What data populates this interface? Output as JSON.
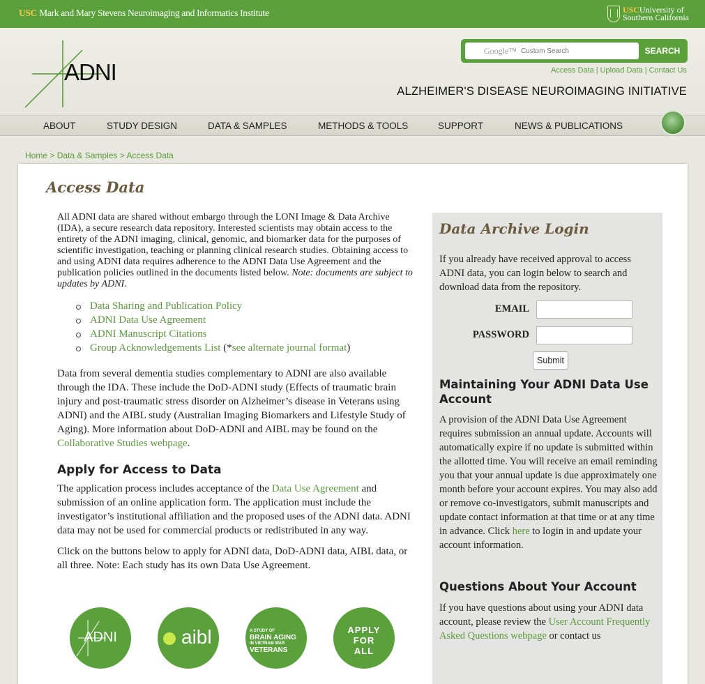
{
  "topbar": {
    "institute_usc": "USC",
    "institute_name": "Mark and Mary Stevens Neuroimaging and Informatics Institute",
    "university_usc": "USC",
    "university_line1": "University of",
    "university_line2": "Southern California"
  },
  "header": {
    "logo_text": "ADNI",
    "search": {
      "placeholder": "Custom Search",
      "google_label": "Google™",
      "button_label": "SEARCH"
    },
    "utility_links": [
      "Access Data",
      "Upload Data",
      "Contact Us"
    ],
    "tagline": "ALZHEIMER'S DISEASE NEUROIMAGING INITIATIVE"
  },
  "nav": {
    "items": [
      "ABOUT",
      "STUDY DESIGN",
      "DATA & SAMPLES",
      "METHODS & TOOLS",
      "SUPPORT",
      "NEWS & PUBLICATIONS"
    ]
  },
  "breadcrumb": {
    "items": [
      "Home",
      "Data & Samples",
      "Access Data"
    ],
    "separator": ">"
  },
  "main": {
    "title": "Access Data",
    "intro": "All ADNI data are shared without embargo through the LONI Image & Data Archive (IDA), a secure research data repository. Interested scientists may obtain access to the entirety of the ADNI imaging, clinical, genomic, and biomarker data for the purposes of scientific investigation, teaching or planning clinical research studies. Obtaining access to and using ADNI data requires adherence to the ADNI Data Use Agreement and the publication policies outlined in the documents listed below.",
    "intro_note": "Note: documents are subject to updates by ADNI",
    "doc_links": [
      "Data Sharing and Publication Policy",
      "ADNI Data Use Agreement",
      "ADNI Manuscript Citations",
      "Group Acknowledgements List"
    ],
    "alt_journal_prefix": " (*",
    "alt_journal_link": "see alternate journal format",
    "alt_journal_suffix": ")",
    "dementia_text": "Data from several dementia studies complementary to ADNI are also available through the IDA. These include the DoD-ADNI study (Effects of traumatic brain injury and post-traumatic stress disorder on Alzheimer’s disease in Veterans using ADNI) and the AIBL study (Australian Imaging Biomarkers and Lifestyle Study of Aging). More information about DoD-ADNI and AIBL may be found on the ",
    "collab_link": "Collaborative Studies webpage",
    "apply_heading": "Apply for Access to Data",
    "apply_text_1": "The application process includes acceptance of the ",
    "apply_link": "Data Use Agreement",
    "apply_text_2": " and submission of an online application form. The application must include the investigator’s institutional affiliation and the proposed uses of the ADNI data. ADNI data may not be used for commercial products or redistributed in any way.",
    "buttons_text": "Click on the buttons below to apply for ADNI data, DoD-ADNI data, AIBL data, or all three. Note: Each study has its own Data Use Agreement.",
    "badges": {
      "adni": "ADNI",
      "aibl": "aibl",
      "vet_line1": "A STUDY OF",
      "vet_line2": "BRAIN AGING",
      "vet_line3": "IN VIETNAM WAR",
      "vet_line4": "VETERANS",
      "all_line1": "APPLY",
      "all_line2": "FOR",
      "all_line3": "ALL"
    }
  },
  "sidebar": {
    "login_title": "Data Archive Login",
    "login_text": "If you already have received approval to access ADNI data, you can login below to search and download data from the repository.",
    "email_label": "EMAIL",
    "password_label": "PASSWORD",
    "email_value": "",
    "password_value": "",
    "submit_label": "Submit",
    "maintain_heading": "Maintaining Your ADNI Data Use Account",
    "maintain_text_1": "A provision of the ADNI Data Use Agreement requires submission an annual update. Accounts will automatically expire if no update is submitted within the allotted time. You will receive an email reminding you that your annual update is due approximately one month before your account expires. You may also add or remove co-investigators, submit manuscripts and update contact information at that time or at any time in advance. Click ",
    "maintain_link": "here",
    "maintain_text_2": " to login in and update your account information.",
    "questions_heading": "Questions About Your Account",
    "questions_text_1": "If you have questions about using your ADNI data account, please review the ",
    "questions_link": "User Account Frequently Asked Questions webpage",
    "questions_text_2": " or contact us"
  },
  "colors": {
    "brand_green": "#5aa13b",
    "link_green": "#5a9a3a",
    "title_brown": "#6b5a3e"
  }
}
